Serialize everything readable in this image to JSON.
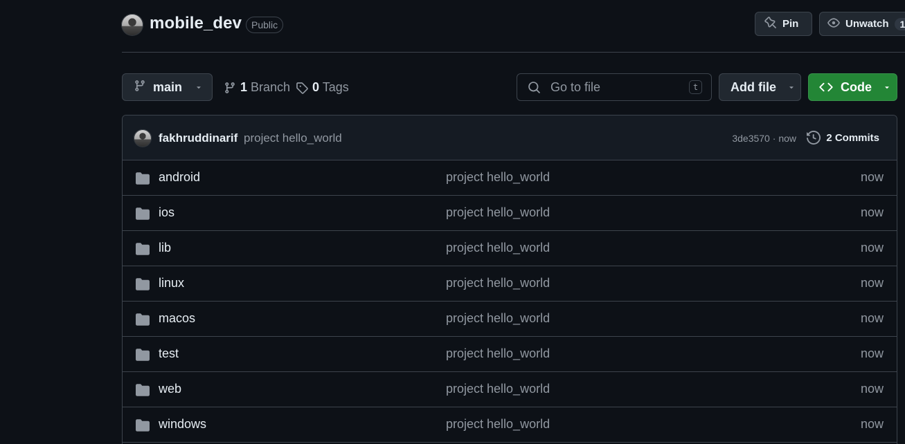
{
  "repo": {
    "name": "mobile_dev",
    "visibility": "Public"
  },
  "header_actions": {
    "pin_label": "Pin",
    "unwatch_label": "Unwatch",
    "watch_count": "1"
  },
  "toolbar": {
    "branch_name": "main",
    "branches_count": "1",
    "branches_label": "Branch",
    "tags_count": "0",
    "tags_label": "Tags",
    "search_placeholder": "Go to file",
    "search_shortcut": "t",
    "add_file_label": "Add file",
    "code_label": "Code"
  },
  "latest_commit": {
    "author": "fakhruddinarif",
    "message": "project hello_world",
    "sha": "3de3570",
    "separator": "·",
    "time": "now",
    "commits_count_label": "2 Commits"
  },
  "files": [
    {
      "name": "android",
      "message": "project hello_world",
      "time": "now"
    },
    {
      "name": "ios",
      "message": "project hello_world",
      "time": "now"
    },
    {
      "name": "lib",
      "message": "project hello_world",
      "time": "now"
    },
    {
      "name": "linux",
      "message": "project hello_world",
      "time": "now"
    },
    {
      "name": "macos",
      "message": "project hello_world",
      "time": "now"
    },
    {
      "name": "test",
      "message": "project hello_world",
      "time": "now"
    },
    {
      "name": "web",
      "message": "project hello_world",
      "time": "now"
    },
    {
      "name": "windows",
      "message": "project hello_world",
      "time": "now"
    }
  ],
  "colors": {
    "background": "#0d1117",
    "border": "#3d444d",
    "muted_text": "#9198a1",
    "code_button": "#238636"
  },
  "icons": {
    "branch": "git-branch-icon",
    "tag": "tag-icon",
    "search": "search-icon",
    "history": "history-icon",
    "folder": "folder-icon",
    "pin": "pin-icon",
    "eye": "eye-icon",
    "code": "code-icon",
    "caret": "caret-down-icon"
  }
}
